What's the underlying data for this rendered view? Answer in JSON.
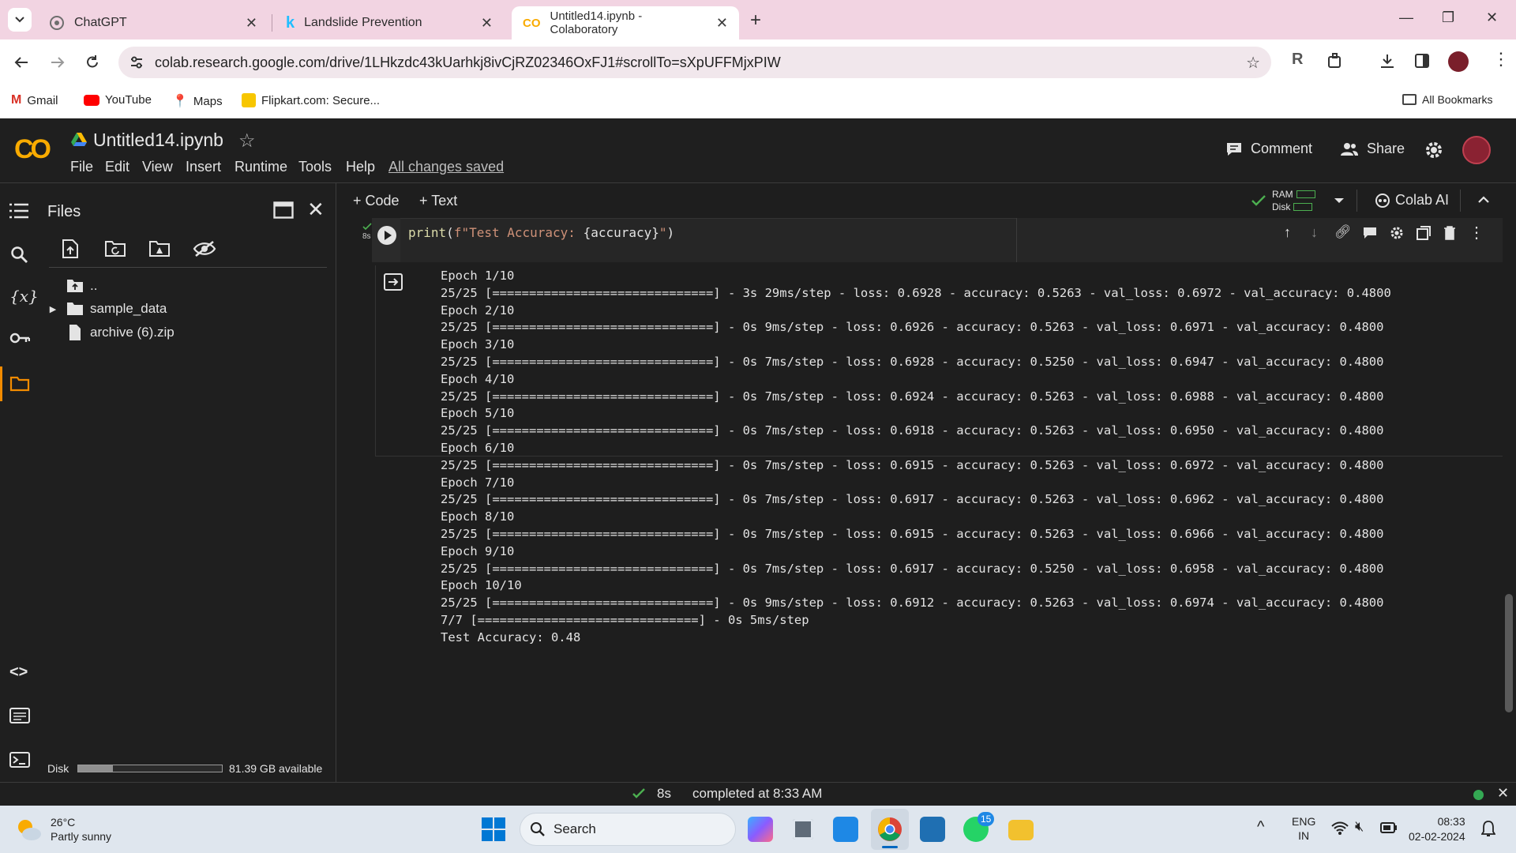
{
  "browser": {
    "tabs": [
      {
        "title": "ChatGPT"
      },
      {
        "title": "Landslide Prevention"
      },
      {
        "title": "Untitled14.ipynb - Colaboratory"
      }
    ],
    "url": "colab.research.google.com/drive/1LHkzdc43kUarhkj8ivCjRZ02346OxFJ1#scrollTo=sXpUFFMjxPIW",
    "bookmarks": [
      "Gmail",
      "YouTube",
      "Maps",
      "Flipkart.com: Secure..."
    ],
    "all_bookmarks": "All Bookmarks"
  },
  "colab": {
    "logo": "CO",
    "title": "Untitled14.ipynb",
    "menu": [
      "File",
      "Edit",
      "View",
      "Insert",
      "Runtime",
      "Tools",
      "Help"
    ],
    "save_status": "All changes saved",
    "comment": "Comment",
    "share": "Share",
    "add_code": "+ Code",
    "add_text": "+ Text",
    "ram": "RAM",
    "disk": "Disk",
    "colab_ai": "Colab AI"
  },
  "files": {
    "title": "Files",
    "tree": [
      "..",
      "sample_data",
      "archive (6).zip"
    ],
    "disk_label": "Disk",
    "disk_available": "81.39 GB available",
    "disk_fill_fraction": 0.24
  },
  "cell": {
    "exec_time": "8s",
    "code": "print(f\"Test Accuracy: {accuracy}\")",
    "output": [
      "Epoch 1/10",
      "25/25 [==============================] - 3s 29ms/step - loss: 0.6928 - accuracy: 0.5263 - val_loss: 0.6972 - val_accuracy: 0.4800",
      "Epoch 2/10",
      "25/25 [==============================] - 0s 9ms/step - loss: 0.6926 - accuracy: 0.5263 - val_loss: 0.6971 - val_accuracy: 0.4800",
      "Epoch 3/10",
      "25/25 [==============================] - 0s 7ms/step - loss: 0.6928 - accuracy: 0.5250 - val_loss: 0.6947 - val_accuracy: 0.4800",
      "Epoch 4/10",
      "25/25 [==============================] - 0s 7ms/step - loss: 0.6924 - accuracy: 0.5263 - val_loss: 0.6988 - val_accuracy: 0.4800",
      "Epoch 5/10",
      "25/25 [==============================] - 0s 7ms/step - loss: 0.6918 - accuracy: 0.5263 - val_loss: 0.6950 - val_accuracy: 0.4800",
      "Epoch 6/10",
      "25/25 [==============================] - 0s 7ms/step - loss: 0.6915 - accuracy: 0.5263 - val_loss: 0.6972 - val_accuracy: 0.4800",
      "Epoch 7/10",
      "25/25 [==============================] - 0s 7ms/step - loss: 0.6917 - accuracy: 0.5263 - val_loss: 0.6962 - val_accuracy: 0.4800",
      "Epoch 8/10",
      "25/25 [==============================] - 0s 7ms/step - loss: 0.6915 - accuracy: 0.5263 - val_loss: 0.6966 - val_accuracy: 0.4800",
      "Epoch 9/10",
      "25/25 [==============================] - 0s 7ms/step - loss: 0.6917 - accuracy: 0.5250 - val_loss: 0.6958 - val_accuracy: 0.4800",
      "Epoch 10/10",
      "25/25 [==============================] - 0s 9ms/step - loss: 0.6912 - accuracy: 0.5263 - val_loss: 0.6974 - val_accuracy: 0.4800",
      "7/7 [==============================] - 0s 5ms/step",
      "Test Accuracy: 0.48"
    ]
  },
  "status": {
    "time": "8s",
    "completed": "completed at 8:33 AM"
  },
  "taskbar": {
    "weather_temp": "26°C",
    "weather_desc": "Partly sunny",
    "search": "Search",
    "whatsapp_badge": "15",
    "lang": "ENG",
    "region": "IN",
    "time": "08:33",
    "date": "02-02-2024"
  },
  "colors": {
    "colab_orange": "#f9ab00",
    "run_ok_green": "#4caf50",
    "code_string": "#ce9178",
    "tab_strip": "#f2d4e2"
  }
}
